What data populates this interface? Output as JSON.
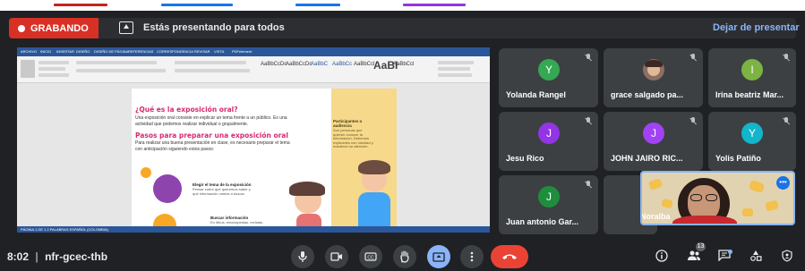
{
  "banner": {
    "recording_label": "GRABANDO",
    "presenting_text": "Estás presentando para todos",
    "stop_presenting_label": "Dejar de presentar"
  },
  "slide": {
    "ribbon_tabs": [
      "ARCHIVO",
      "INICIO",
      "INSERTAR",
      "DISEÑO",
      "DISEÑO DE PÁGINA",
      "REFERENCIAS",
      "CORRESPONDENCIA",
      "REVISAR",
      "VISTA",
      "PDFelement"
    ],
    "ribbon_styles": [
      "AaBbCcDc",
      "AaBbCcDc",
      "AaBbC",
      "AaBbCc",
      "AaBbCcl",
      "AaBbCcl"
    ],
    "ribbon_big_style": "AaBI",
    "page_title": "¿Qué es la exposición oral?",
    "page_para1": "Una exposición oral consiste en explicar un tema frente a un público. Es una actividad que podemos realizar individual o grupalmente.",
    "page_subtitle": "Pasos para preparar una exposición oral",
    "page_para2": "Para realizar una buena presentación en clase, es necesario preparar el tema con anticipación siguiendo estos pasos:",
    "note_title": "Participantes o audiencia",
    "note_text": "Son personas que quieren conocer la información. Debemos explicarles con claridad y mantener su atención.",
    "step1_title": "Elegir el tema de la exposición",
    "step1_text": "Pensar sobre qué queremos saber y qué información vamos a buscar.",
    "step2_title": "Buscar información",
    "step2_text": "En libros, enciclopedias, revistas.",
    "status_left": "PÁGINA 1 DE 1    2 PALABRAS    ESPAÑOL (COLOMBIA)"
  },
  "participants": [
    {
      "initial": "Y",
      "name": "Yolanda Rangel",
      "color": "#34a853"
    },
    {
      "initial": "",
      "name": "grace salgado pa...",
      "color": "#8d6e63"
    },
    {
      "initial": "I",
      "name": "Irina beatriz Mar...",
      "color": "#7cb342"
    },
    {
      "initial": "J",
      "name": "Jesu Rico",
      "color": "#9334e6"
    },
    {
      "initial": "J",
      "name": "JOHN JAIRO RIC...",
      "color": "#a142f4"
    },
    {
      "initial": "Y",
      "name": "Yolis Patiño",
      "color": "#12b5cb"
    },
    {
      "initial": "J",
      "name": "Juan antonio Gar...",
      "color": "#1e8e3e"
    }
  ],
  "self_view": {
    "name": "Noralba",
    "more_label": "•••"
  },
  "meeting": {
    "time": "8:02",
    "separator": "|",
    "code": "nfr-gcec-thb",
    "participant_count": "13"
  },
  "controls": {
    "mic_icon": "mic-icon",
    "camera_icon": "camera-icon",
    "captions_icon": "captions-icon",
    "hand_icon": "raise-hand-icon",
    "present_icon": "present-icon",
    "more_icon": "more-vert-icon",
    "end_icon": "end-call-icon"
  }
}
